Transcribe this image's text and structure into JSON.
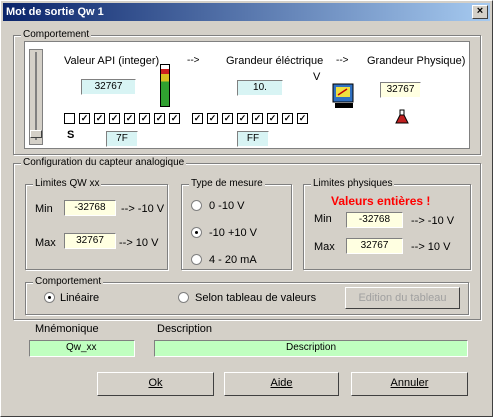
{
  "window": {
    "title": "Mot de sortie Qw 1",
    "close_glyph": "×"
  },
  "comportement_top": {
    "legend": "Comportement",
    "api_label": "Valeur API (integer)",
    "arrow1": "-->",
    "elec_label": "Grandeur éléctrique",
    "arrow2": "-->",
    "phys_label": "Grandeur Physique)",
    "unit_letter": "V",
    "api_value": "32767",
    "elec_value": "10.",
    "phys_value": "32767",
    "s_label": "S",
    "hex_high": "7F",
    "hex_low": "FF",
    "bit_states": [
      "empty",
      "checked",
      "checked",
      "checked",
      "checked",
      "checked",
      "checked",
      "checked",
      "checked",
      "checked",
      "checked",
      "checked",
      "checked",
      "checked",
      "checked",
      "checked"
    ],
    "bar_level": 0.9
  },
  "config": {
    "legend": "Configuration du capteur analogique",
    "limites_qw": {
      "legend": "Limites QW xx",
      "min_label": "Min",
      "max_label": "Max",
      "min_value": "-32768",
      "max_value": "32767",
      "min_result": "--> -10 V",
      "max_result": "--> 10 V"
    },
    "type_mesure": {
      "legend": "Type de mesure",
      "options": [
        "0 -10 V",
        "-10 +10 V",
        "4 - 20 mA"
      ],
      "selected_index": 1
    },
    "limites_phys": {
      "legend": "Limites physiques",
      "warning": "Valeurs entières !",
      "min_label": "Min",
      "max_label": "Max",
      "min_value": "-32768",
      "max_value": "32767",
      "min_result": "--> -10 V",
      "max_result": "--> 10 V"
    },
    "comportement": {
      "legend": "Comportement",
      "option_lineaire": "Linéaire",
      "option_tableau": "Selon tableau de valeurs",
      "edit_button": "Edition du tableau",
      "selected": "lineaire"
    }
  },
  "mnemonique": {
    "label": "Mnémonique",
    "value": "Qw_xx"
  },
  "description": {
    "label": "Description",
    "value": "Description"
  },
  "buttons": {
    "ok": "Ok",
    "aide": "Aide",
    "annuler": "Annuler"
  },
  "colors": {
    "warning": "#ff0000",
    "titlebar_start": "#0a246a",
    "titlebar_end": "#a6caf0"
  }
}
